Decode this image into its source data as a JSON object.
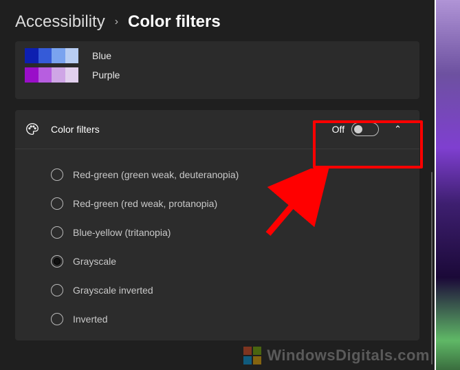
{
  "breadcrumb": {
    "parent": "Accessibility",
    "current": "Color filters"
  },
  "preview": {
    "rows": [
      {
        "label": "Blue"
      },
      {
        "label": "Purple"
      }
    ]
  },
  "section": {
    "title": "Color filters",
    "toggle_label": "Off",
    "toggle_on": false,
    "expanded": true
  },
  "options": [
    {
      "label": "Red-green (green weak, deuteranopia)",
      "selected": false
    },
    {
      "label": "Red-green (red weak, protanopia)",
      "selected": false
    },
    {
      "label": "Blue-yellow (tritanopia)",
      "selected": false
    },
    {
      "label": "Grayscale",
      "selected": true
    },
    {
      "label": "Grayscale inverted",
      "selected": false
    },
    {
      "label": "Inverted",
      "selected": false
    }
  ],
  "watermark": {
    "text_a": "Windows",
    "text_b": "Digitals",
    "text_c": ".com"
  },
  "annotation": {
    "highlight_target": "color-filters-toggle",
    "arrow_points_to": "color-filters-toggle"
  }
}
